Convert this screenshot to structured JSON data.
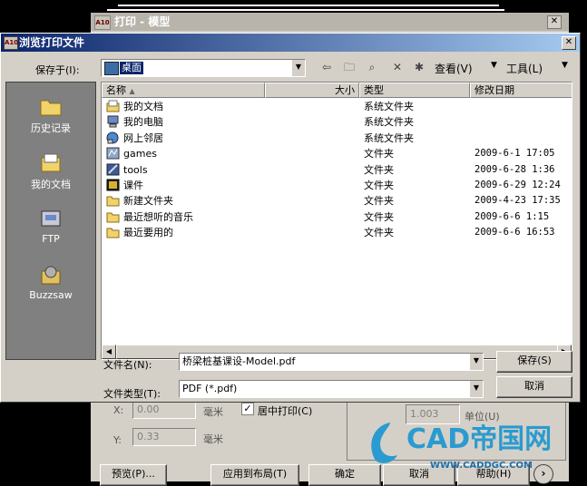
{
  "background_dialog": {
    "title": "打印 - 模型",
    "icon_text": "A10",
    "x_label": "X:",
    "x_value": "0.00",
    "y_label": "Y:",
    "y_value": "0.33",
    "mm1": "毫米",
    "mm2": "毫米",
    "center_plot": "居中打印(C)",
    "scale_value": "1.003",
    "unit_label": "单位(U)",
    "buttons": {
      "preview": "预览(P)...",
      "apply_layout": "应用到布局(T)",
      "ok": "确定",
      "cancel": "取消",
      "help": "帮助(H)"
    }
  },
  "dialog": {
    "title": "浏览打印文件",
    "icon_text": "A10",
    "save_in_label": "保存于(I):",
    "save_in_value": "桌面",
    "view_menu": "查看(V)",
    "tools_menu": "工具(L)",
    "places": [
      {
        "label": "历史记录",
        "icon": "history-folder-icon"
      },
      {
        "label": "我的文档",
        "icon": "my-documents-icon"
      },
      {
        "label": "FTP",
        "icon": "ftp-icon"
      },
      {
        "label": "Buzzsaw",
        "icon": "buzzsaw-icon"
      }
    ],
    "columns": {
      "name": "名称",
      "size": "大小",
      "type": "类型",
      "modified": "修改日期"
    },
    "files": [
      {
        "name": "我的文档",
        "type": "系统文件夹",
        "date": "",
        "icon": "my-documents-icon"
      },
      {
        "name": "我的电脑",
        "type": "系统文件夹",
        "date": "",
        "icon": "my-computer-icon"
      },
      {
        "name": "网上邻居",
        "type": "系统文件夹",
        "date": "",
        "icon": "network-places-icon"
      },
      {
        "name": "games",
        "type": "文件夹",
        "date": "2009-6-1 17:05",
        "icon": "games-folder-icon"
      },
      {
        "name": "tools",
        "type": "文件夹",
        "date": "2009-6-28 1:36",
        "icon": "tools-folder-icon"
      },
      {
        "name": "课件",
        "type": "文件夹",
        "date": "2009-6-29 12:24",
        "icon": "courseware-folder-icon"
      },
      {
        "name": "新建文件夹",
        "type": "文件夹",
        "date": "2009-4-23 17:35",
        "icon": "folder-icon"
      },
      {
        "name": "最近想听的音乐",
        "type": "文件夹",
        "date": "2009-6-6 1:15",
        "icon": "folder-icon"
      },
      {
        "name": "最近要用的",
        "type": "文件夹",
        "date": "2009-6-6 16:53",
        "icon": "folder-icon"
      }
    ],
    "file_name_label": "文件名(N):",
    "file_name_value": "桥梁桩基课设-Model.pdf",
    "file_type_label": "文件类型(T):",
    "file_type_value": "PDF (*.pdf)",
    "save_button": "保存(S)",
    "cancel_button": "取消"
  },
  "watermark": {
    "logo": "CAD帝国网",
    "url": "WWW.CADDGC.COM"
  },
  "colors": {
    "title_start": "#0a246a",
    "title_end": "#a6caf0",
    "face": "#d4d0c8",
    "places_bg": "#808080",
    "watermark": "#2a9bd0"
  }
}
